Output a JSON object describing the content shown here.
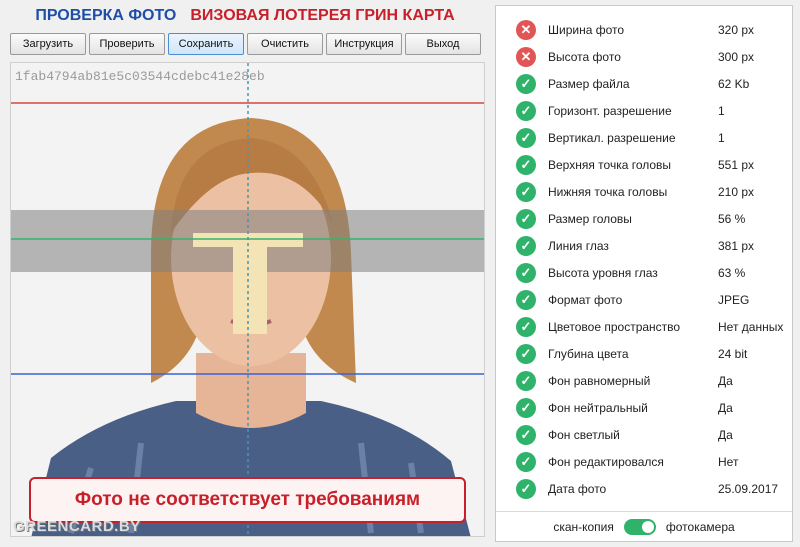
{
  "header": {
    "title_left": "ПРОВЕРКА ФОТО",
    "title_right": "ВИЗОВАЯ ЛОТЕРЕЯ ГРИН КАРТА"
  },
  "toolbar": {
    "buttons": [
      {
        "label": "Загрузить"
      },
      {
        "label": "Проверить"
      },
      {
        "label": "Сохранить"
      },
      {
        "label": "Очистить"
      },
      {
        "label": "Инструкция"
      },
      {
        "label": "Выход"
      }
    ]
  },
  "photo": {
    "hash": "1fab4794ab81e5c03544cdebc41e28eb",
    "verdict": "Фото не соответствует требованиям",
    "watermark": "GREENCARD.BY"
  },
  "checks": [
    {
      "label": "Ширина фото",
      "value": "320 px",
      "status": "fail"
    },
    {
      "label": "Высота фото",
      "value": "300 px",
      "status": "fail"
    },
    {
      "label": "Размер файла",
      "value": "62 Kb",
      "status": "ok"
    },
    {
      "label": "Горизонт. разрешение",
      "value": "1",
      "status": "ok"
    },
    {
      "label": "Вертикал. разрешение",
      "value": "1",
      "status": "ok"
    },
    {
      "label": "Верхняя точка головы",
      "value": "551 px",
      "status": "ok"
    },
    {
      "label": "Нижняя точка головы",
      "value": "210 px",
      "status": "ok"
    },
    {
      "label": "Размер головы",
      "value": "56 %",
      "status": "ok"
    },
    {
      "label": "Линия глаз",
      "value": "381 px",
      "status": "ok"
    },
    {
      "label": "Высота уровня глаз",
      "value": "63 %",
      "status": "ok"
    },
    {
      "label": "Формат фото",
      "value": "JPEG",
      "status": "ok"
    },
    {
      "label": "Цветовое пространство",
      "value": "Нет данных",
      "status": "ok"
    },
    {
      "label": "Глубина цвета",
      "value": "24 bit",
      "status": "ok"
    },
    {
      "label": "Фон равномерный",
      "value": "Да",
      "status": "ok"
    },
    {
      "label": "Фон нейтральный",
      "value": "Да",
      "status": "ok"
    },
    {
      "label": "Фон светлый",
      "value": "Да",
      "status": "ok"
    },
    {
      "label": "Фон редактировался",
      "value": "Нет",
      "status": "ok"
    },
    {
      "label": "Дата фото",
      "value": "25.09.2017",
      "status": "ok"
    }
  ],
  "footer": {
    "left_label": "скан-копия",
    "right_label": "фотокамера",
    "toggle_on": true
  },
  "colors": {
    "ok": "#2fb36b",
    "fail": "#e25555",
    "title_blue": "#1f4ea8",
    "title_red": "#c8202a"
  }
}
